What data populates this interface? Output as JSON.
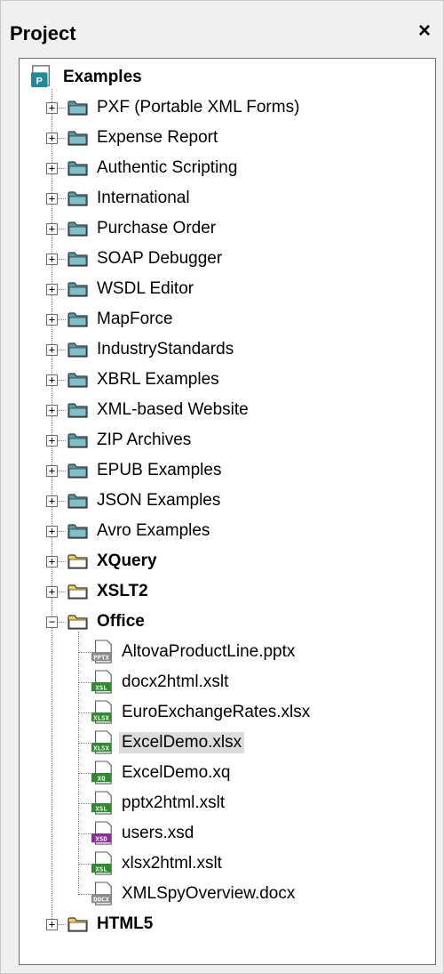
{
  "panel": {
    "title": "Project",
    "close_label": "×"
  },
  "root": {
    "label": "Examples",
    "icon": "project-icon"
  },
  "folders": [
    {
      "label": "PXF (Portable XML Forms)",
      "color": "#4f9ba6",
      "expander": "+"
    },
    {
      "label": "Expense Report",
      "color": "#4f9ba6",
      "expander": "+"
    },
    {
      "label": "Authentic Scripting",
      "color": "#4f9ba6",
      "expander": "+"
    },
    {
      "label": "International",
      "color": "#4f9ba6",
      "expander": "+"
    },
    {
      "label": "Purchase Order",
      "color": "#4f9ba6",
      "expander": "+"
    },
    {
      "label": "SOAP Debugger",
      "color": "#4f9ba6",
      "expander": "+"
    },
    {
      "label": "WSDL Editor",
      "color": "#4f9ba6",
      "expander": "+"
    },
    {
      "label": "MapForce",
      "color": "#4f9ba6",
      "expander": "+"
    },
    {
      "label": "IndustryStandards",
      "color": "#4f9ba6",
      "expander": "+"
    },
    {
      "label": "XBRL Examples",
      "color": "#4f9ba6",
      "expander": "+"
    },
    {
      "label": "XML-based Website",
      "color": "#4f9ba6",
      "expander": "+"
    },
    {
      "label": "ZIP Archives",
      "color": "#4f9ba6",
      "expander": "+"
    },
    {
      "label": "EPUB Examples",
      "color": "#4f9ba6",
      "expander": "+"
    },
    {
      "label": "JSON Examples",
      "color": "#4f9ba6",
      "expander": "+"
    },
    {
      "label": "Avro Examples",
      "color": "#4f9ba6",
      "expander": "+"
    },
    {
      "label": "XQuery",
      "color": "#f7d24a",
      "expander": "+",
      "bold": true
    },
    {
      "label": "XSLT2",
      "color": "#f7d24a",
      "expander": "+",
      "bold": true
    },
    {
      "label": "Office",
      "color": "#f7d24a",
      "expander": "−",
      "bold": true,
      "open": true
    }
  ],
  "office_files": [
    {
      "label": "AltovaProductLine.pptx",
      "badge": "PPTX",
      "badge_color": "#8c8c8c"
    },
    {
      "label": "docx2html.xslt",
      "badge": "XSL",
      "badge_color": "#2e8b2e"
    },
    {
      "label": "EuroExchangeRates.xlsx",
      "badge": "XLSX",
      "badge_color": "#2e8b2e"
    },
    {
      "label": "ExcelDemo.xlsx",
      "badge": "XLSX",
      "badge_color": "#2e8b2e",
      "selected": true
    },
    {
      "label": "ExcelDemo.xq",
      "badge": "XQ",
      "badge_color": "#2e8b2e"
    },
    {
      "label": "pptx2html.xslt",
      "badge": "XSL",
      "badge_color": "#2e8b2e"
    },
    {
      "label": "users.xsd",
      "badge": "XSD",
      "badge_color": "#8b2e9b"
    },
    {
      "label": "xlsx2html.xslt",
      "badge": "XSL",
      "badge_color": "#2e8b2e"
    },
    {
      "label": "XMLSpyOverview.docx",
      "badge": "DOCX",
      "badge_color": "#8c8c8c"
    }
  ],
  "last_folder": {
    "label": "HTML5",
    "color": "#f7d24a",
    "expander": "+",
    "bold": true
  }
}
